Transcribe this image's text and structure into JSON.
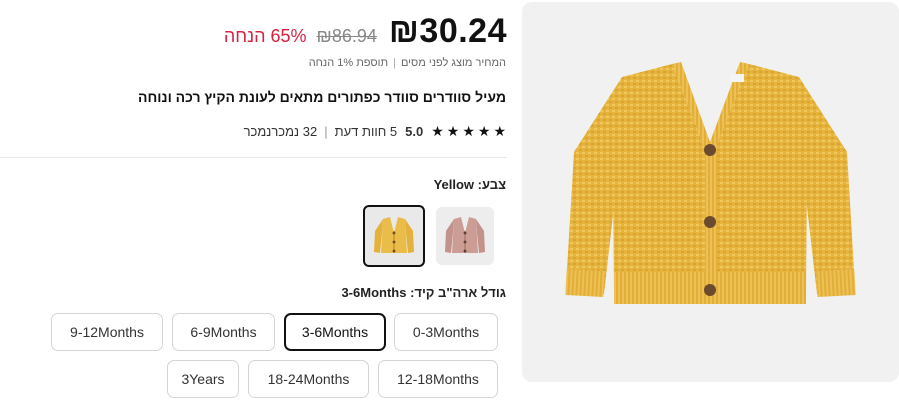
{
  "price": {
    "current": "₪30.24",
    "original": "₪86.94",
    "discount": "65% הנחה"
  },
  "tax_note": {
    "part1": "המחיר מוצג לפני מסים",
    "part2": "תוספת 1% הנחה"
  },
  "product": {
    "title": "מעיל סוודרים סוודר כפתורים מתאים לעונת הקיץ רכה ונוחה"
  },
  "rating": {
    "stars": 5,
    "score": "5.0",
    "reviews": "5 חוות דעת",
    "sold": "32 נמכרנמכר"
  },
  "color": {
    "label": "צבע: Yellow",
    "swatches": [
      {
        "name": "Yellow",
        "color": "#e8b43a",
        "selected": true
      },
      {
        "name": "Pink",
        "color": "#c9978d",
        "selected": false
      }
    ]
  },
  "size": {
    "label": "גודל ארה\"ב קיד: 3-6Months",
    "options": [
      "0-3Months",
      "3-6Months",
      "6-9Months",
      "9-12Months",
      "12-18Months",
      "18-24Months",
      "3Years"
    ],
    "selected": "3-6Months"
  },
  "colors": {
    "discount_red": "#d6223f",
    "sweater_yellow": "#e8b43a",
    "panel_bg": "#f1f1f2"
  }
}
